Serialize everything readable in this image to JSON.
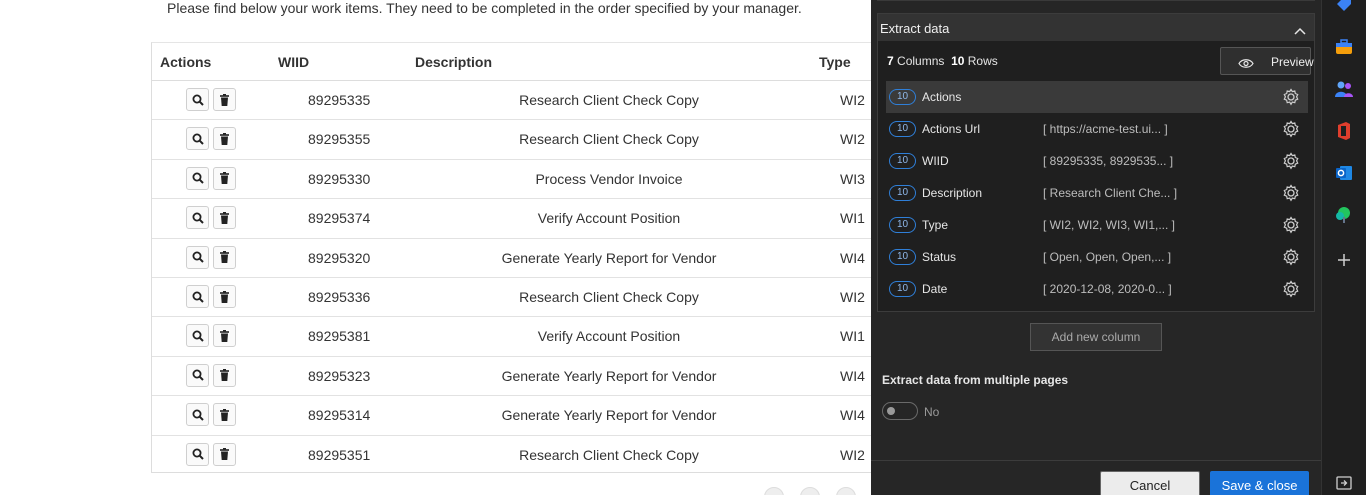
{
  "page": {
    "intro_text": "Please find below your work items. They need to be completed in the order specified by your manager."
  },
  "table": {
    "headers": {
      "actions": "Actions",
      "wiid": "WIID",
      "description": "Description",
      "type": "Type"
    },
    "rows": [
      {
        "wiid": "89295335",
        "description": "Research Client Check Copy",
        "type": "WI2"
      },
      {
        "wiid": "89295355",
        "description": "Research Client Check Copy",
        "type": "WI2"
      },
      {
        "wiid": "89295330",
        "description": "Process Vendor Invoice",
        "type": "WI3"
      },
      {
        "wiid": "89295374",
        "description": "Verify Account Position",
        "type": "WI1"
      },
      {
        "wiid": "89295320",
        "description": "Generate Yearly Report for Vendor",
        "type": "WI4"
      },
      {
        "wiid": "89295336",
        "description": "Research Client Check Copy",
        "type": "WI2"
      },
      {
        "wiid": "89295381",
        "description": "Verify Account Position",
        "type": "WI1"
      },
      {
        "wiid": "89295323",
        "description": "Generate Yearly Report for Vendor",
        "type": "WI4"
      },
      {
        "wiid": "89295314",
        "description": "Generate Yearly Report for Vendor",
        "type": "WI4"
      },
      {
        "wiid": "89295351",
        "description": "Research Client Check Copy",
        "type": "WI2"
      }
    ]
  },
  "extract_panel": {
    "title": "Extract data",
    "columns_count": "7",
    "columns_label": "Columns",
    "rows_count": "10",
    "rows_label": "Rows",
    "preview_label": "Preview",
    "columns": [
      {
        "count": "10",
        "name": "Actions",
        "value": ""
      },
      {
        "count": "10",
        "name": "Actions Url",
        "value": "[ https://acme-test.ui... ]"
      },
      {
        "count": "10",
        "name": "WIID",
        "value": "[ 89295335, 8929535... ]"
      },
      {
        "count": "10",
        "name": "Description",
        "value": "[ Research Client Che... ]"
      },
      {
        "count": "10",
        "name": "Type",
        "value": "[ WI2, WI2, WI3, WI1,... ]"
      },
      {
        "count": "10",
        "name": "Status",
        "value": "[ Open, Open, Open,... ]"
      },
      {
        "count": "10",
        "name": "Date",
        "value": "[ 2020-12-08, 2020-0... ]"
      }
    ],
    "add_column_label": "Add new column",
    "multi_pages_label": "Extract data from multiple pages",
    "multi_pages_value": "No",
    "cancel_label": "Cancel",
    "save_label": "Save & close"
  },
  "colors": {
    "accent": "#1a73d9",
    "panel_bg": "#262626",
    "badge_border": "#2f7fd8"
  }
}
